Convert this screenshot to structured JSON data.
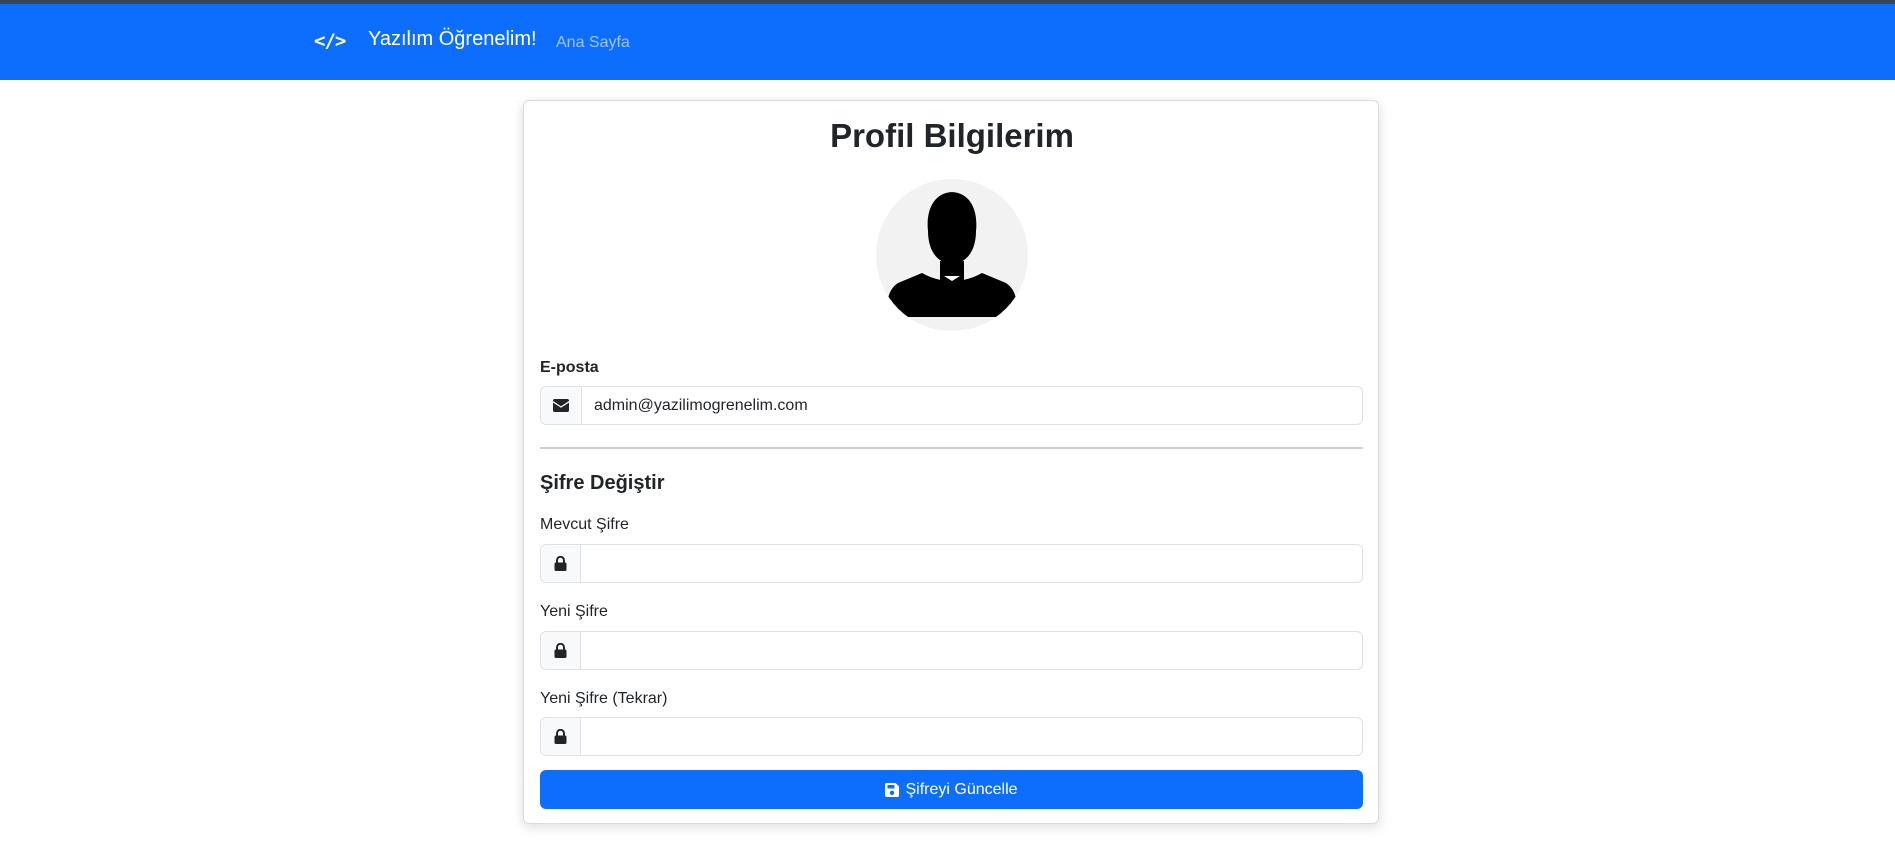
{
  "navbar": {
    "brand_icon": "</>",
    "brand_text": "Yazılım Öğrenelim!",
    "links": [
      {
        "label": "Ana Sayfa"
      }
    ]
  },
  "profile": {
    "title": "Profil Bilgilerim",
    "avatar_icon": "user-silhouette-icon"
  },
  "email": {
    "label": "E-posta",
    "icon": "envelope-icon",
    "value": "admin@yazilimogrenelim.com"
  },
  "password_change": {
    "title": "Şifre Değiştir",
    "fields": [
      {
        "label": "Mevcut Şifre",
        "icon": "lock-icon",
        "value": ""
      },
      {
        "label": "Yeni Şifre",
        "icon": "lock-icon",
        "value": ""
      },
      {
        "label": "Yeni Şifre (Tekrar)",
        "icon": "lock-icon",
        "value": ""
      }
    ],
    "submit_icon": "save-icon",
    "submit_label": "Şifreyi Güncelle"
  },
  "colors": {
    "primary": "#0d6efd",
    "topline": "#3a4654",
    "avatar_bg": "#f2f2f2"
  }
}
